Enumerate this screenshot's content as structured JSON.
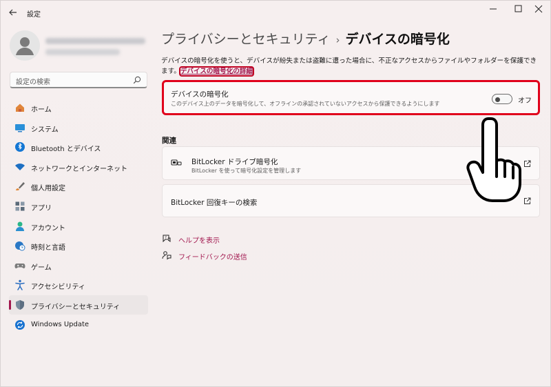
{
  "window": {
    "title": "設定"
  },
  "profile": {
    "name_hidden": true
  },
  "search": {
    "placeholder": "設定の検索"
  },
  "sidebar": {
    "items": [
      {
        "label": "ホーム",
        "icon": "home-icon",
        "color": "#d9534f"
      },
      {
        "label": "システム",
        "icon": "system-icon",
        "color": "#2a7fc9"
      },
      {
        "label": "Bluetooth とデバイス",
        "icon": "bluetooth-icon",
        "color": "#1477d4"
      },
      {
        "label": "ネットワークとインターネット",
        "icon": "wifi-icon",
        "color": "#1d6fc2"
      },
      {
        "label": "個人用設定",
        "icon": "brush-icon",
        "color": "#e08a3c"
      },
      {
        "label": "アプリ",
        "icon": "apps-icon",
        "color": "#5b6b7a"
      },
      {
        "label": "アカウント",
        "icon": "account-icon",
        "color": "#2bb68a"
      },
      {
        "label": "時刻と言語",
        "icon": "globe-clock-icon",
        "color": "#2b78c5"
      },
      {
        "label": "ゲーム",
        "icon": "gamepad-icon",
        "color": "#7b7b7b"
      },
      {
        "label": "アクセシビリティ",
        "icon": "accessibility-icon",
        "color": "#2a6dc0"
      },
      {
        "label": "プライバシーとセキュリティ",
        "icon": "shield-icon",
        "color": "#6d7f92",
        "selected": true
      },
      {
        "label": "Windows Update",
        "icon": "update-icon",
        "color": "#1a73d0"
      }
    ]
  },
  "main": {
    "breadcrumb_parent": "プライバシーとセキュリティ",
    "breadcrumb_sep": "›",
    "breadcrumb_current": "デバイスの暗号化",
    "description": "デバイスの暗号化を使うと、デバイスが紛失または盗難に遭った場合に、不正なアクセスからファイルやフォルダーを保護できます。",
    "description_link": "デバイスの暗号化の詳細",
    "encrypt_card": {
      "title": "デバイスの暗号化",
      "subtitle": "このデバイス上のデータを暗号化して、オフラインの承認されていないアクセスから保護できるようにします",
      "toggle_state": "オフ",
      "toggle_on": false
    },
    "related_label": "関連",
    "bitlocker_card": {
      "title": "BitLocker ドライブ暗号化",
      "subtitle": "BitLocker を使って暗号化設定を管理します"
    },
    "recovery_card": {
      "title": "BitLocker 回復キーの検索"
    },
    "help_link": "ヘルプを表示",
    "feedback_link": "フィードバックの送信"
  },
  "colors": {
    "accent": "#a2174e",
    "highlight_border": "#e0001b"
  }
}
